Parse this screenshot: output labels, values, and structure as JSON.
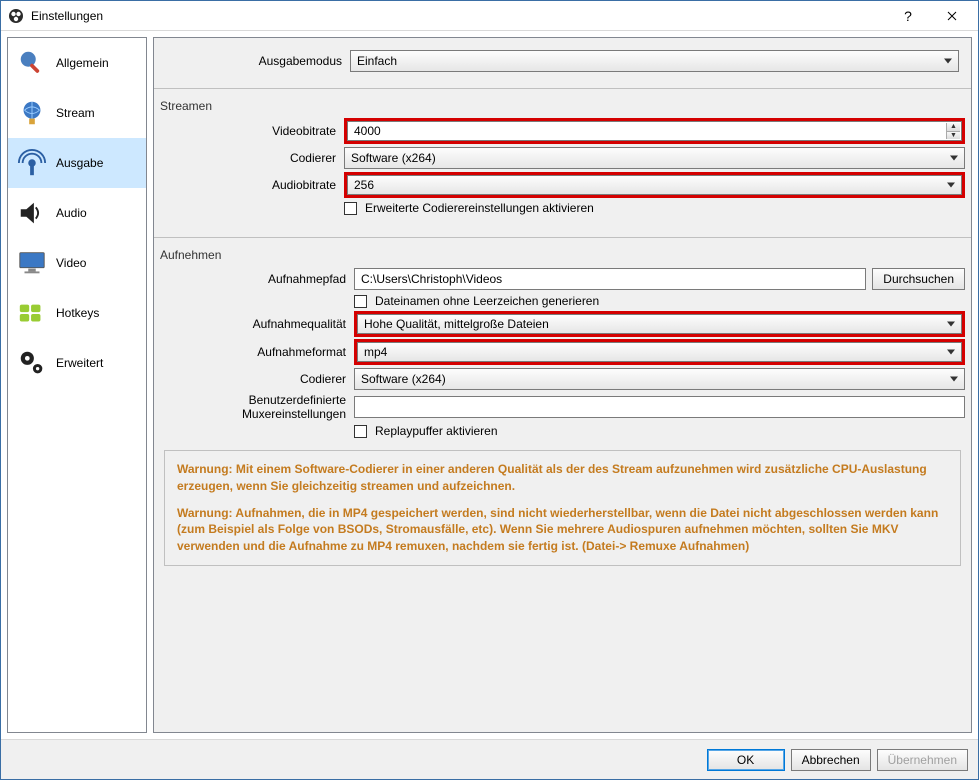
{
  "window": {
    "title": "Einstellungen"
  },
  "sidebar": {
    "items": [
      {
        "label": "Allgemein"
      },
      {
        "label": "Stream"
      },
      {
        "label": "Ausgabe"
      },
      {
        "label": "Audio"
      },
      {
        "label": "Video"
      },
      {
        "label": "Hotkeys"
      },
      {
        "label": "Erweitert"
      }
    ]
  },
  "output": {
    "mode_label": "Ausgabemodus",
    "mode_value": "Einfach"
  },
  "stream": {
    "section_title": "Streamen",
    "video_bitrate_label": "Videobitrate",
    "video_bitrate_value": "4000",
    "encoder_label": "Codierer",
    "encoder_value": "Software (x264)",
    "audio_bitrate_label": "Audiobitrate",
    "audio_bitrate_value": "256",
    "advanced_encoder_checkbox": "Erweiterte Codierereinstellungen aktivieren"
  },
  "record": {
    "section_title": "Aufnehmen",
    "path_label": "Aufnahmepfad",
    "path_value": "C:\\Users\\Christoph\\Videos",
    "browse_button": "Durchsuchen",
    "no_spaces_checkbox": "Dateinamen ohne Leerzeichen generieren",
    "quality_label": "Aufnahmequalität",
    "quality_value": "Hohe Qualität, mittelgroße Dateien",
    "format_label": "Aufnahmeformat",
    "format_value": "mp4",
    "encoder_label": "Codierer",
    "encoder_value": "Software (x264)",
    "muxer_label": "Benutzerdefinierte Muxereinstellungen",
    "muxer_value": "",
    "replay_buffer_checkbox": "Replaypuffer aktivieren"
  },
  "warnings": {
    "w1": "Warnung: Mit einem Software-Codierer in einer anderen Qualität als der des Stream aufzunehmen wird zusätzliche CPU-Auslastung erzeugen, wenn Sie gleichzeitig streamen und aufzeichnen.",
    "w2": "Warnung: Aufnahmen, die in MP4 gespeichert werden, sind nicht wiederherstellbar, wenn die Datei nicht abgeschlossen werden kann (zum Beispiel als Folge von BSODs, Stromausfälle, etc). Wenn Sie mehrere Audiospuren aufnehmen möchten, sollten Sie MKV verwenden und die Aufnahme zu MP4 remuxen, nachdem sie fertig ist. (Datei-> Remuxe Aufnahmen)"
  },
  "footer": {
    "ok": "OK",
    "cancel": "Abbrechen",
    "apply": "Übernehmen"
  }
}
